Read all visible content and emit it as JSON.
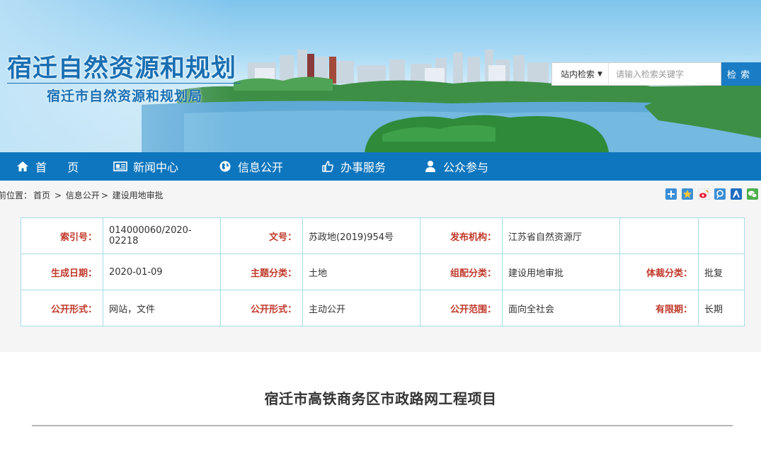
{
  "header": {
    "site_title": "宿迁自然资源和规划",
    "site_subtitle": "宿迁市自然资源和规划局"
  },
  "search": {
    "scope_label": "站内检索",
    "placeholder": "请输入检索关键字",
    "button_label": "检 索"
  },
  "nav": {
    "items": [
      {
        "label": "首 页",
        "icon": "home-icon"
      },
      {
        "label": "新闻中心",
        "icon": "newspaper-icon"
      },
      {
        "label": "信息公开",
        "icon": "globe-icon"
      },
      {
        "label": "办事服务",
        "icon": "thumbs-up-icon"
      },
      {
        "label": "公众参与",
        "icon": "user-icon"
      }
    ]
  },
  "breadcrumb": {
    "prefix": "前位置：",
    "items": [
      "首页",
      "信息公开",
      "建设用地审批"
    ],
    "separator": ">"
  },
  "share": {
    "icons": [
      "share-plus-icon",
      "qzone-icon",
      "weibo-icon",
      "tencent-weibo-icon",
      "renren-icon",
      "wechat-icon"
    ]
  },
  "info": {
    "rows": [
      [
        {
          "key": "索引号：",
          "value": "014000060/2020-02218"
        },
        {
          "key": "文号：",
          "value": "苏政地(2019)954号"
        },
        {
          "key": "发布机构：",
          "value": "江苏省自然资源厅"
        },
        {
          "key": "",
          "value": ""
        }
      ],
      [
        {
          "key": "生成日期：",
          "value": "2020-01-09"
        },
        {
          "key": "主题分类：",
          "value": "土地"
        },
        {
          "key": "组配分类：",
          "value": "建设用地审批"
        },
        {
          "key": "体裁分类：",
          "value": "批复"
        }
      ],
      [
        {
          "key": "公开形式：",
          "value": "网站，文件"
        },
        {
          "key": "公开形式：",
          "value": "主动公开"
        },
        {
          "key": "公开范围：",
          "value": "面向全社会"
        },
        {
          "key": "有限期：",
          "value": "长期"
        }
      ]
    ]
  },
  "article": {
    "title": "宿迁市高铁商务区市政路网工程项目"
  }
}
